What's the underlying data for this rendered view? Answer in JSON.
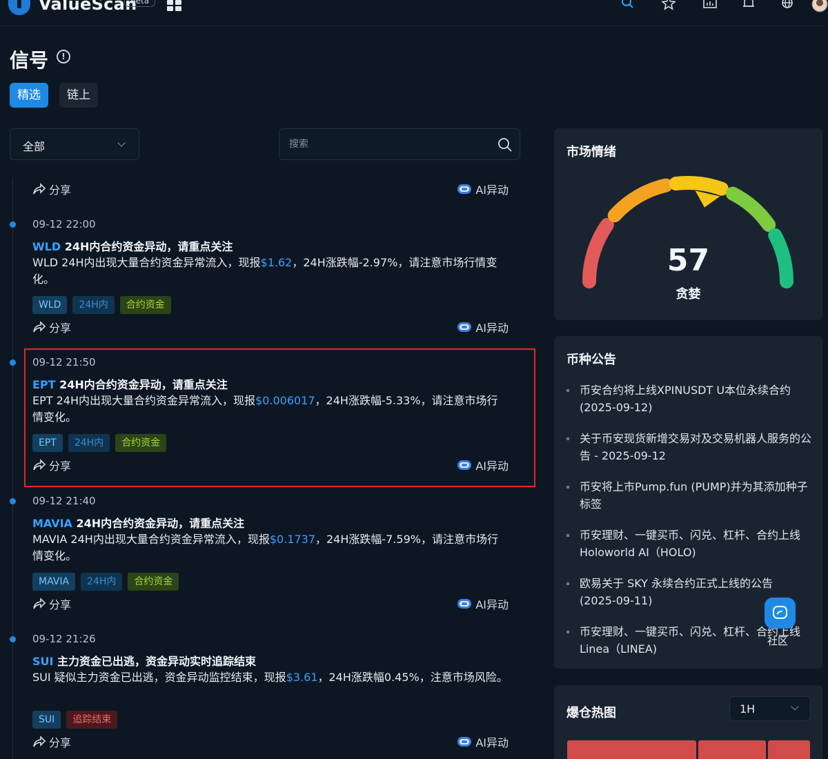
{
  "header": {
    "app_name": "ValueScan",
    "badge": "beta"
  },
  "page": {
    "title": "信号",
    "tabs": [
      {
        "label": "精选",
        "active": true
      },
      {
        "label": "链上",
        "active": false
      }
    ]
  },
  "filters": {
    "category": "全部",
    "search_placeholder": "搜索"
  },
  "feed": {
    "share_label": "分享",
    "ai_label": "AI异动",
    "items": [
      {
        "time": "09-12 22:00",
        "symbol": "WLD",
        "title_rest": " 24H内合约资金异动，请重点关注",
        "body_pre": "WLD 24H内出现大量合约资金异常流入，现报",
        "price": "$1.62",
        "body_post": "，24H涨跌幅-2.97%，请注意市场行情变化。",
        "tags": [
          "WLD",
          "24H内",
          "合约资金"
        ]
      },
      {
        "time": "09-12 21:50",
        "symbol": "EPT",
        "title_rest": " 24H内合约资金异动，请重点关注",
        "body_pre": "EPT 24H内出现大量合约资金异常流入，现报",
        "price": "$0.006017",
        "body_post": "，24H涨跌幅-5.33%，请注意市场行情变化。",
        "tags": [
          "EPT",
          "24H内",
          "合约资金"
        ]
      },
      {
        "time": "09-12 21:40",
        "symbol": "MAVIA",
        "title_rest": " 24H内合约资金异动，请重点关注",
        "body_pre": "MAVIA 24H内出现大量合约资金异常流入，现报",
        "price": "$0.1737",
        "body_post": "，24H涨跌幅-7.59%，请注意市场行情变化。",
        "tags": [
          "MAVIA",
          "24H内",
          "合约资金"
        ]
      },
      {
        "time": "09-12 21:26",
        "symbol": "SUI",
        "title_rest": " 主力资金已出逃，资金异动实时追踪结束",
        "body_pre": "SUI 疑似主力资金已出逃，资金异动监控结束，现报",
        "price": "$3.61",
        "body_post": "，24H涨跌幅0.45%，注意市场风险。",
        "tags": [
          "SUI",
          "追踪结束"
        ]
      }
    ]
  },
  "sentiment": {
    "title": "市场情绪",
    "value": "57",
    "label": "贪婪",
    "level": 0.57,
    "colors": {
      "fear": "#e25a5a",
      "caution": "#f4a321",
      "neutral": "#f5c518",
      "optimism": "#7ecb3f",
      "greed": "#1fbf82"
    }
  },
  "announcements": {
    "title": "币种公告",
    "items": [
      "币安合约将上线XPINUSDT U本位永续合约(2025-09-12)",
      "关于币安现货新增交易对及交易机器人服务的公告 - 2025-09-12",
      "币安将上市Pump.fun (PUMP)并为其添加种子标签",
      "币安理财、一键买币、闪兑、杠杆、合约上线Holoworld AI（HOLO)",
      "欧易关于 SKY 永续合约正式上线的公告 (2025-09-11)",
      "币安理财、一键买币、闪兑、杠杆、合约上线Linea（LINEA)"
    ]
  },
  "community": {
    "label": "社区"
  },
  "heatmap": {
    "title": "爆仓热图",
    "interval": "1H"
  }
}
